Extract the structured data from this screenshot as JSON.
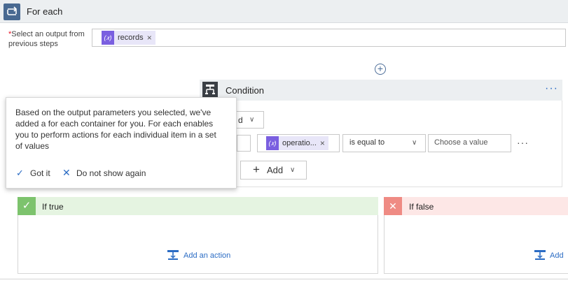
{
  "foreach": {
    "title": "For each",
    "icon": "loop-icon",
    "accent": "#486991"
  },
  "select_output": {
    "required_marker": "*",
    "label": "Select an output from previous steps",
    "token": {
      "label": "records",
      "icon": "expression-icon",
      "remove": "×"
    }
  },
  "add_step_icon": "+",
  "condition": {
    "title": "Condition",
    "menu": "···",
    "and_select": {
      "value": "d",
      "chevron": "∨"
    },
    "row": {
      "left_token": {
        "label": "operatio...",
        "icon": "expression-icon",
        "remove": "×"
      },
      "operator": {
        "value": "is equal to",
        "chevron": "∨"
      },
      "value_placeholder": "Choose a value",
      "more": "···"
    },
    "add_button": {
      "plus": "+",
      "label": "Add",
      "chevron": "∨"
    }
  },
  "tooltip": {
    "text": "Based on the output parameters you selected, we've added a for each container for you. For each enables you to perform actions for each individual item in a set of values",
    "got_it": "Got it",
    "dont_show": "Do not show again"
  },
  "if_true": {
    "title": "If true",
    "color": "#7dc36d",
    "add_action": "Add an action"
  },
  "if_false": {
    "title": "If false",
    "color": "#ef8b84",
    "add_action": "Add"
  },
  "colors": {
    "link": "#2b6cc4",
    "token": "#7a5fe0"
  }
}
